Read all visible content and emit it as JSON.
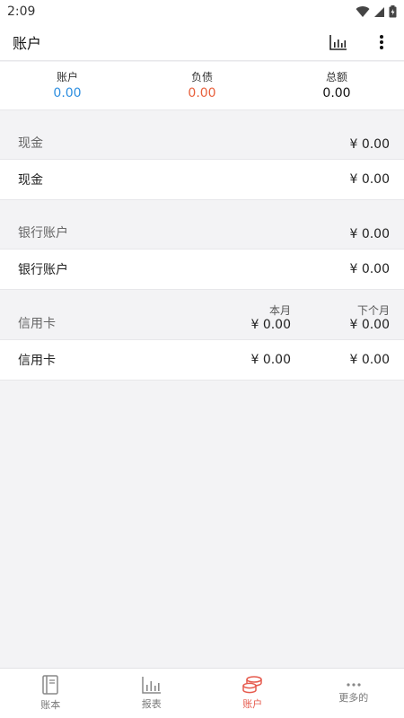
{
  "status": {
    "time": "2:09"
  },
  "header": {
    "title": "账户"
  },
  "summary": [
    {
      "label": "账户",
      "value": "0.00",
      "color": "#2e8fe0"
    },
    {
      "label": "负债",
      "value": "0.00",
      "color": "#e8603c"
    },
    {
      "label": "总额",
      "value": "0.00",
      "color": "#111111"
    }
  ],
  "cash": {
    "title": "现金",
    "total": "¥ 0.00",
    "row_label": "现金",
    "row_amount": "¥ 0.00"
  },
  "bank": {
    "title": "银行账户",
    "total": "¥ 0.00",
    "row_label": "银行账户",
    "row_amount": "¥ 0.00"
  },
  "credit": {
    "title": "信用卡",
    "col1_head": "本月",
    "col2_head": "下个月",
    "col1_total": "¥ 0.00",
    "col2_total": "¥ 0.00",
    "row_label": "信用卡",
    "row_col1": "¥ 0.00",
    "row_col2": "¥ 0.00"
  },
  "nav": [
    {
      "label": "账本",
      "icon": "book-icon"
    },
    {
      "label": "报表",
      "icon": "bar-chart-icon"
    },
    {
      "label": "账户",
      "icon": "coins-icon",
      "active": true
    },
    {
      "label": "更多的",
      "icon": "more-horizontal-icon"
    }
  ],
  "colors": {
    "accent": "#e65b4e",
    "asset": "#2e8fe0",
    "liability": "#e8603c"
  }
}
